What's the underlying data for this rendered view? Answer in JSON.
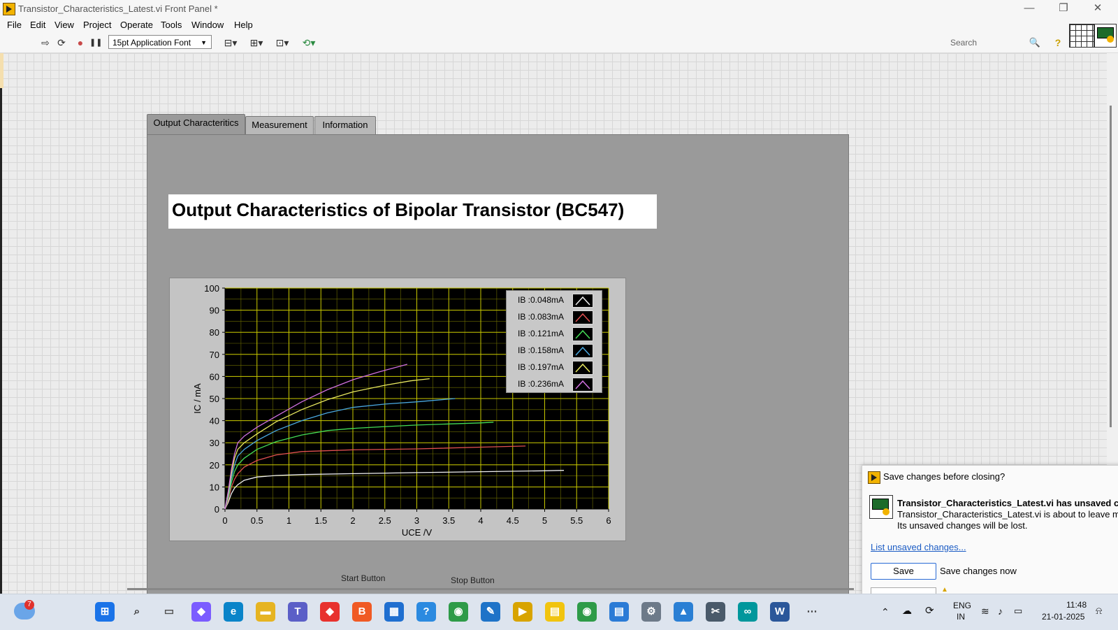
{
  "window": {
    "title": "Transistor_Characteristics_Latest.vi Front Panel *",
    "minimize": "—",
    "restore": "❐",
    "close": "✕"
  },
  "menu": [
    "File",
    "Edit",
    "View",
    "Project",
    "Operate",
    "Tools",
    "Window",
    "Help"
  ],
  "toolbar": {
    "font": "15pt Application Font",
    "search_placeholder": "Search",
    "run_icon": "⇨",
    "run_cont_icon": "⟳",
    "abort_icon": "●",
    "pause_icon": "❚❚",
    "align_icon": "⊟▾",
    "distribute_icon": "⊞▾",
    "resize_icon": "⊡▾",
    "reorder_icon": "⟲▾",
    "search_icon": "🔍",
    "help_icon": "?"
  },
  "tabs": [
    "Output Characteritics",
    "Measurement",
    "Information"
  ],
  "panel_title": "Output Characteristics of Bipolar Transistor (BC547)",
  "buttons_hint": {
    "start": "Start Button",
    "stop": "Stop Button"
  },
  "chart_data": {
    "type": "line",
    "title": "",
    "xlabel": "UCE /V",
    "ylabel": "IC / mA",
    "xlim": [
      0,
      6
    ],
    "ylim": [
      0,
      100
    ],
    "x_ticks": [
      "0",
      "0.5",
      "1",
      "1.5",
      "2",
      "2.5",
      "3",
      "3.5",
      "4",
      "4.5",
      "5",
      "5.5",
      "6"
    ],
    "y_ticks": [
      "0",
      "10",
      "20",
      "30",
      "40",
      "50",
      "60",
      "70",
      "80",
      "90",
      "100"
    ],
    "grid": true,
    "legend_position": "top-right",
    "series": [
      {
        "name": "IB :0.048mA",
        "color": "#f0f0f0",
        "x": [
          0,
          0.05,
          0.1,
          0.15,
          0.2,
          0.3,
          0.5,
          0.8,
          1.2,
          2,
          3,
          4,
          5,
          5.3
        ],
        "y": [
          0,
          3,
          7,
          9.5,
          11,
          13,
          14.5,
          15.2,
          15.6,
          16,
          16.5,
          16.9,
          17.3,
          17.5
        ]
      },
      {
        "name": "IB :0.083mA",
        "color": "#e05050",
        "x": [
          0,
          0.05,
          0.1,
          0.15,
          0.2,
          0.3,
          0.5,
          0.8,
          1.2,
          2,
          3,
          4,
          4.7
        ],
        "y": [
          0,
          4,
          10,
          13.5,
          16,
          19,
          22,
          24.5,
          26,
          26.8,
          27.2,
          28,
          28.5
        ]
      },
      {
        "name": "IB :0.121mA",
        "color": "#44dd55",
        "x": [
          0,
          0.05,
          0.1,
          0.15,
          0.2,
          0.3,
          0.5,
          0.8,
          1.2,
          1.6,
          2,
          2.5,
          3,
          3.5,
          4,
          4.2
        ],
        "y": [
          0,
          5,
          12,
          17,
          20,
          23,
          27,
          30.5,
          33.5,
          35.5,
          36.5,
          37.3,
          38,
          38.5,
          39,
          39.3
        ]
      },
      {
        "name": "IB :0.158mA",
        "color": "#4aa8e0",
        "x": [
          0,
          0.05,
          0.1,
          0.15,
          0.2,
          0.3,
          0.5,
          0.8,
          1.2,
          1.6,
          2,
          2.5,
          3,
          3.6
        ],
        "y": [
          0,
          6,
          14,
          20,
          24,
          27,
          31,
          35.5,
          40,
          43.5,
          46,
          47.5,
          48.5,
          50
        ]
      },
      {
        "name": "IB :0.197mA",
        "color": "#e8e860",
        "x": [
          0,
          0.05,
          0.1,
          0.15,
          0.2,
          0.3,
          0.5,
          0.8,
          1.2,
          1.6,
          2,
          2.5,
          2.9,
          3.2
        ],
        "y": [
          0,
          7,
          16,
          23,
          27,
          30,
          34,
          39.5,
          45,
          49.5,
          53,
          56,
          58,
          59
        ]
      },
      {
        "name": "IB :0.236mA",
        "color": "#d070e0",
        "x": [
          0,
          0.05,
          0.1,
          0.15,
          0.2,
          0.3,
          0.5,
          0.8,
          1.2,
          1.6,
          2,
          2.4,
          2.85
        ],
        "y": [
          0,
          8,
          18,
          25,
          30,
          33,
          37,
          42,
          48.5,
          54,
          58.5,
          62,
          65.5
        ]
      }
    ]
  },
  "dialog": {
    "title": "Save changes before closing?",
    "heading": "Transistor_Characteristics_Latest.vi has unsaved change",
    "line1": "Transistor_Characteristics_Latest.vi is about to leave memo",
    "line2": "Its unsaved changes will be lost.",
    "link": "List unsaved changes...",
    "save_label": "Save",
    "save_desc": "Save changes now"
  },
  "taskbar": {
    "weather_badge": "7",
    "apps": [
      {
        "name": "start",
        "glyph": "⊞",
        "color": "#1a73e8"
      },
      {
        "name": "search",
        "glyph": "⌕",
        "color": "#333333"
      },
      {
        "name": "task-view",
        "glyph": "▭",
        "color": "#555555"
      },
      {
        "name": "copilot",
        "glyph": "◆",
        "color": "#7b5cff"
      },
      {
        "name": "edge",
        "glyph": "e",
        "color": "#0a84c9"
      },
      {
        "name": "file-explorer",
        "glyph": "▬",
        "color": "#e6b422"
      },
      {
        "name": "teams",
        "glyph": "T",
        "color": "#5b5fc7"
      },
      {
        "name": "app-red",
        "glyph": "◆",
        "color": "#e8322e"
      },
      {
        "name": "brave",
        "glyph": "B",
        "color": "#f05a24"
      },
      {
        "name": "store",
        "glyph": "▦",
        "color": "#1f6fd0"
      },
      {
        "name": "help-app",
        "glyph": "?",
        "color": "#2b8ae0"
      },
      {
        "name": "chrome",
        "glyph": "◉",
        "color": "#2e9b48"
      },
      {
        "name": "app-yellow",
        "glyph": "✎",
        "color": "#1e73c8"
      },
      {
        "name": "labview",
        "glyph": "▶",
        "color": "#d8a400"
      },
      {
        "name": "sticky-notes",
        "glyph": "▤",
        "color": "#f1c40f"
      },
      {
        "name": "chrome-2",
        "glyph": "◉",
        "color": "#2e9b48"
      },
      {
        "name": "notepad",
        "glyph": "▤",
        "color": "#2b7bd6"
      },
      {
        "name": "settings",
        "glyph": "⚙",
        "color": "#6d7a89"
      },
      {
        "name": "photos",
        "glyph": "▲",
        "color": "#2a7fd4"
      },
      {
        "name": "snipping",
        "glyph": "✂",
        "color": "#4a5a6a"
      },
      {
        "name": "arduino",
        "glyph": "∞",
        "color": "#00979c"
      },
      {
        "name": "word",
        "glyph": "W",
        "color": "#2b579a"
      },
      {
        "name": "more",
        "glyph": "⋯",
        "color": "#444444"
      }
    ],
    "tray": {
      "lang_top": "ENG",
      "lang_bottom": "IN",
      "time": "11:48",
      "date": "21-01-2025"
    }
  }
}
